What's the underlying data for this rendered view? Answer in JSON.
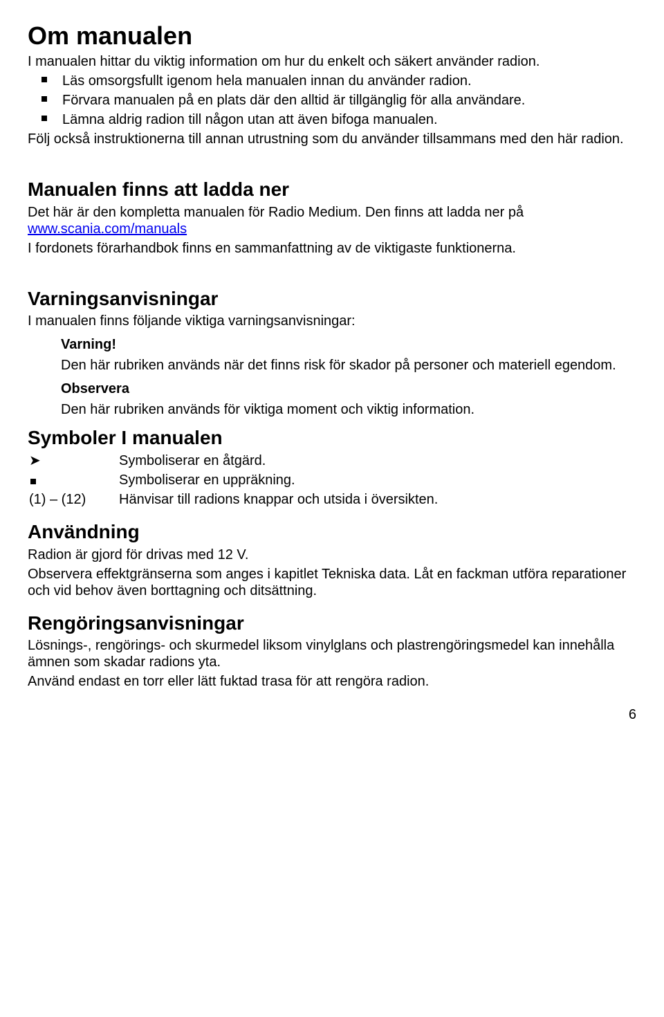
{
  "section1": {
    "heading": "Om manualen",
    "intro": "I manualen hittar du viktig information om hur du enkelt och säkert använder radion.",
    "bullets": [
      "Läs omsorgsfullt igenom hela manualen innan du använder radion.",
      "Förvara manualen på en plats där den alltid är tillgänglig för alla användare.",
      "Lämna aldrig radion till någon utan att även bifoga manualen."
    ],
    "outro": "Följ också instruktionerna till annan utrustning som du använder tillsammans med den här radion."
  },
  "section2": {
    "heading": "Manualen finns att ladda ner",
    "p1a": "Det här är den kompletta manualen för Radio Medium. Den finns att ladda ner på ",
    "link": "www.scania.com/manuals",
    "p2": "I fordonets förarhandbok finns en sammanfattning av de viktigaste funktionerna."
  },
  "section3": {
    "heading": "Varningsanvisningar",
    "intro": "I manualen finns följande viktiga varningsanvisningar:",
    "varning_label": "Varning!",
    "varning_text": "Den här rubriken används när det finns risk för skador på personer och materiell egendom.",
    "observera_label": "Observera",
    "observera_text": "Den här rubriken används för viktiga moment och viktig information."
  },
  "section4": {
    "heading": "Symboler I manualen",
    "rows": [
      {
        "marker": "➤",
        "text": "Symboliserar en åtgärd."
      },
      {
        "marker": "■",
        "text": "Symboliserar en uppräkning."
      },
      {
        "marker": "(1) – (12)",
        "text": "Hänvisar till radions knappar och utsida i översikten."
      }
    ]
  },
  "section5": {
    "heading": "Användning",
    "p1": "Radion är gjord för drivas med 12 V.",
    "p2": "Observera effektgränserna som anges i kapitlet Tekniska data. Låt en fackman utföra reparationer och vid behov även borttagning och ditsättning."
  },
  "section6": {
    "heading": "Rengöringsanvisningar",
    "p1": "Lösnings-, rengörings- och skurmedel liksom vinylglans och plastrengöringsmedel kan innehålla ämnen som skadar radions yta.",
    "p2": "Använd endast en torr eller lätt fuktad trasa för att rengöra radion."
  },
  "page_number": "6"
}
